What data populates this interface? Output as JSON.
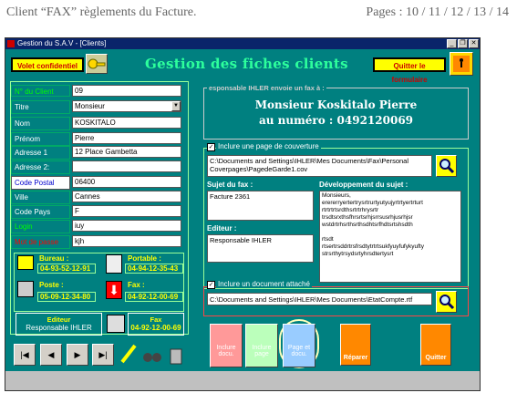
{
  "header": {
    "left": "Client “FAX” règlements du Facture.",
    "right": "Pages : 10 / 11 / 12 / 13 / 14"
  },
  "window": {
    "title": "Gestion du S.A.V - [Clients]"
  },
  "top": {
    "volet": "Volet confidentiel",
    "main_title": "Gestion des fiches clients",
    "quitter": "Quitter le formulaire"
  },
  "form": {
    "num_label": "N° du Client",
    "num": "09",
    "titre_label": "Titre",
    "titre": "Monsieur",
    "nom_label": "Nom",
    "nom": "KOSKITALO",
    "prenom_label": "Prénom",
    "prenom": "Pierre",
    "adr1_label": "Adresse 1",
    "adr1": "12 Place Gambetta",
    "adr2_label": "Adresse 2:",
    "adr2": "",
    "cp_label": "Code Postal",
    "cp": "06400",
    "ville_label": "Ville",
    "ville": "Cannes",
    "pays_label": "Code Pays",
    "pays": "F",
    "login_label": "Login",
    "login": "iuy",
    "mdp_label": "Mot de passe",
    "mdp": "kjh"
  },
  "phones": {
    "bureau_label": "Bureau :",
    "bureau": "04-93-52-12-91",
    "portable_label": "Portable :",
    "portable": "04-94-12-35-43",
    "poste_label": "Poste :",
    "poste": "05-09-12-34-80",
    "fax_label": "Fax :",
    "fax": "04-92-12-00-69"
  },
  "editeur": {
    "label": "Editeur",
    "name": "Responsable IHLER",
    "fax_label": "Fax",
    "fax": "04-92-12-00-69"
  },
  "envoi": {
    "caption": "esponsable IHLER envoie un fax à :",
    "line1": "Monsieur Koskitalo Pierre",
    "line2": "au numéro : 0492120069"
  },
  "cover": {
    "checkbox": "Inclure une page de couverture",
    "path": "C:\\Documents and Settings\\IHLER\\Mes Documents\\Fax\\Personal Coverpages\\PagedeGarde1.cov",
    "sujet_label": "Sujet du fax :",
    "sujet": "Facture 2361",
    "dev_label": "Développement du sujet :",
    "dev": "Monsieurs,\nerererryertertrysrtrurtyutyujyrtrtyertrturt\nrtrtrtrtsrdthsrtrtrhrysrtr\ntrsdtsrxthsfhrsrtsrhjsrrsusrhjusrhjsr\nwstdrtrhsrthsrthsdhtsrfhdtsrtshsdth\n\nrtsdt\nrtsertrsddrtrsfrsdtytrtrtsukfyuyfufykyufty\nstrsrthytrsydsrtyhrsdtertysrt",
    "editeur_label": "Editeur :",
    "editeur": "Responsable IHLER"
  },
  "attach": {
    "checkbox": "Inclure un document attaché",
    "path": "C:\\Documents and Settings\\IHLER\\Mes Documents\\EtatCompte.rtf"
  },
  "actions": {
    "inclure_docu": "Inclure docu.",
    "inclure_page": "Inclure page",
    "page_docu": "Page et docu.",
    "reparer": "Réparer",
    "quitter": "Quitter"
  },
  "nav": {
    "first": "|◀",
    "prev": "◀",
    "next": "▶",
    "last": "▶|"
  },
  "colors": {
    "teal": "#008080",
    "green": "#2dff9c",
    "red": "#ff0000"
  }
}
